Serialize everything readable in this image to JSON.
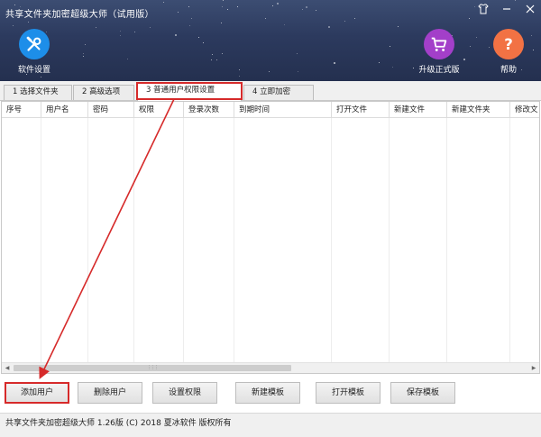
{
  "window": {
    "title": "共享文件夹加密超级大师（试用版）",
    "controls": [
      "shirt-icon",
      "minimize-icon",
      "close-icon"
    ]
  },
  "toolbar": {
    "settings_label": "软件设置",
    "upgrade_label": "升级正式版",
    "help_label": "帮助"
  },
  "tabs": [
    {
      "label": "1 选择文件夹"
    },
    {
      "label": "2 高级选项"
    },
    {
      "label": "3 普通用户权限设置",
      "active": true
    },
    {
      "label": "4 立即加密"
    }
  ],
  "table": {
    "columns": [
      "序号",
      "用户名",
      "密码",
      "权限",
      "登录次数",
      "到期时间",
      "打开文件",
      "新建文件",
      "新建文件夹",
      "修改文"
    ],
    "rows": []
  },
  "buttons": {
    "add_user": "添加用户",
    "delete_user": "删除用户",
    "set_permission": "设置权限",
    "new_template": "新建模板",
    "open_template": "打开模板",
    "save_template": "保存模板"
  },
  "status": {
    "text": "共享文件夹加密超级大师  1.26版  (C) 2018 夏冰软件 版权所有"
  },
  "colors": {
    "accent_red": "#d62a2a",
    "header_bg": "#2c3a5e",
    "settings_icon": "#1d8ee9",
    "upgrade_icon": "#a33fc9",
    "help_icon": "#f27244"
  }
}
